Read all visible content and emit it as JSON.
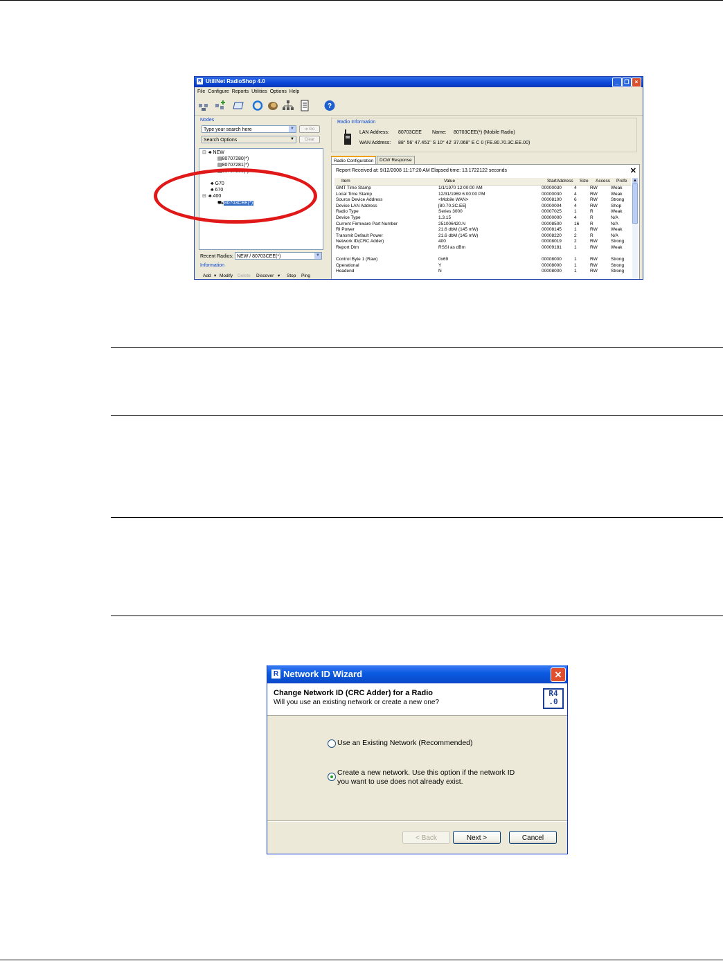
{
  "radioshop": {
    "title": "UtiliNet RadioShop 4.0",
    "menu": [
      "File",
      "Configure",
      "Reports",
      "Utilities",
      "Options",
      "Help"
    ],
    "nodes_label": "Nodes",
    "search_placeholder": "Type your search here",
    "go_label": "Go",
    "search_options_label": "Search Options",
    "clear_label": "Clear",
    "tree": {
      "root": "NEW",
      "children": [
        "80707280(*)",
        "80707281(*)",
        "80707286(*)"
      ],
      "g670a": "G70",
      "g670b": "670",
      "g400": "400",
      "selected": "80703CEE(*)"
    },
    "recent_radios_label": "Recent Radios:",
    "recent_radios_value": "NEW / 80703CEE(*)",
    "information_label": "Information",
    "bottom_buttons": [
      "Add",
      "Modify",
      "Delete",
      "Discover",
      "Stop",
      "Ping"
    ],
    "radio_info": {
      "group_label": "Radio Information",
      "lan_label": "LAN Address:",
      "lan_value": "80703CEE",
      "name_label": "Name:",
      "name_value": "80703CEE(*) (Mobile Radio)",
      "wan_label": "WAN Address:",
      "wan_value": "88° 56' 47.451'' S 10° 42' 37.068'' E C 0 (FE.80.70.3C.EE.00)"
    },
    "tabs": [
      "Radio Configuration",
      "DCW Response"
    ],
    "report_text": "Report Received at: 9/12/2008 11:17:20 AM Elapsed time: 13.1722122 seconds",
    "columns": [
      "Item",
      "Value",
      "StartAddress",
      "Size",
      "Access",
      "Profe"
    ],
    "rows": [
      [
        "GMT Time Stamp",
        "1/1/1970 12:00:00 AM",
        "00000030",
        "4",
        "RW",
        "Weak"
      ],
      [
        "Local Time Stamp",
        "12/31/1969 6:00:00 PM",
        "00000030",
        "4",
        "RW",
        "Weak"
      ],
      [
        "Source Device Address",
        "<Mobile WAN>",
        "00008100",
        "6",
        "RW",
        "Strong"
      ],
      [
        "Device LAN Address",
        "[80.70.3C.EE]",
        "00000004",
        "4",
        "RW",
        "Shop"
      ],
      [
        "Radio Type",
        "Series 3000",
        "00007025",
        "1",
        "R",
        "Weak"
      ],
      [
        "Device Type",
        "1.3.15",
        "00000000",
        "4",
        "R",
        "N/A"
      ],
      [
        "Current Firmware Part Number",
        "251006420.N",
        "00008500",
        "16",
        "R",
        "N/A"
      ],
      [
        "RI Power",
        "21.6 dbM (145 mW)",
        "00008145",
        "1",
        "RW",
        "Weak"
      ],
      [
        "Transmit Default Power",
        "21.6 dbM (145 mW)",
        "00008220",
        "2",
        "R",
        "N/A"
      ],
      [
        "Network ID(CRC Adder)",
        "400",
        "00008019",
        "2",
        "RW",
        "Strong"
      ],
      [
        "Report Dtm",
        "RSSI as dBm",
        "00009181",
        "1",
        "RW",
        "Weak"
      ],
      [
        "",
        "",
        "",
        "",
        "",
        ""
      ],
      [
        "Control Byte 1 (Raw)",
        "0x69",
        "00008000",
        "1",
        "RW",
        "Strong"
      ],
      [
        "Operational",
        "Y",
        "00008000",
        "1",
        "RW",
        "Strong"
      ],
      [
        "Headend",
        "N",
        "00008000",
        "1",
        "RW",
        "Strong"
      ]
    ]
  },
  "wizard": {
    "title": "Network ID Wizard",
    "heading": "Change Network ID (CRC Adder) for a Radio",
    "subheading": "Will you use an existing network or create a new one?",
    "logo_text": "RS4.0",
    "option_existing": "Use an Existing Network (Recommended)",
    "option_new_line1": "Create a new network.  Use this option if the network ID",
    "option_new_line2": "you want to use does not already exist.",
    "selected_option": "new",
    "back_label": "< Back",
    "next_label": "Next >",
    "cancel_label": "Cancel"
  }
}
